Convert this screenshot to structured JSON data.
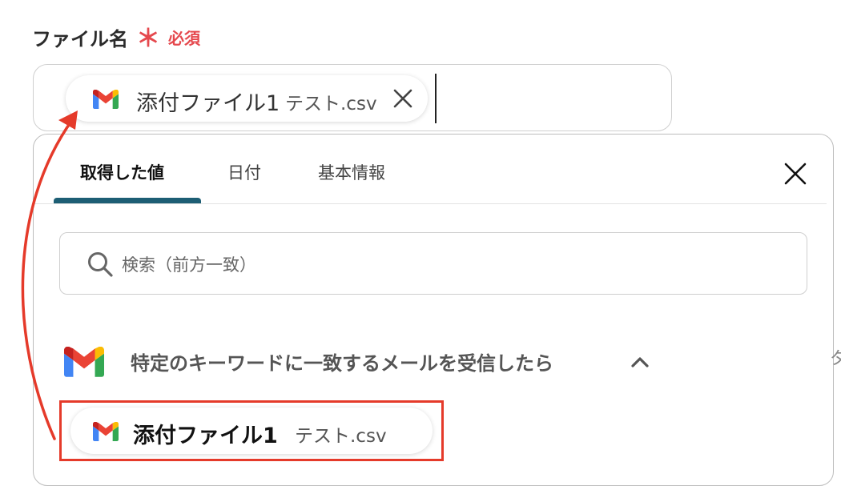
{
  "field": {
    "label": "ファイル名",
    "required_mark": "＊",
    "required_text": "必須"
  },
  "selected_chip": {
    "icon": "gmail-icon",
    "name": "添付ファイル1",
    "file": "テスト.csv"
  },
  "tabs": [
    {
      "label": "取得した値",
      "active": true
    },
    {
      "label": "日付",
      "active": false
    },
    {
      "label": "基本情報",
      "active": false
    }
  ],
  "search": {
    "placeholder": "検索（前方一致）"
  },
  "section": {
    "icon": "gmail-icon",
    "title": "特定のキーワードに一致するメールを受信したら",
    "expanded": true
  },
  "option_chip": {
    "icon": "gmail-icon",
    "name": "添付ファイル1",
    "file": "テスト.csv"
  },
  "edge_text": "タ",
  "colors": {
    "required": "#e5484d",
    "tab_indicator": "#1d5e74",
    "annotation": "#e53a2a"
  }
}
